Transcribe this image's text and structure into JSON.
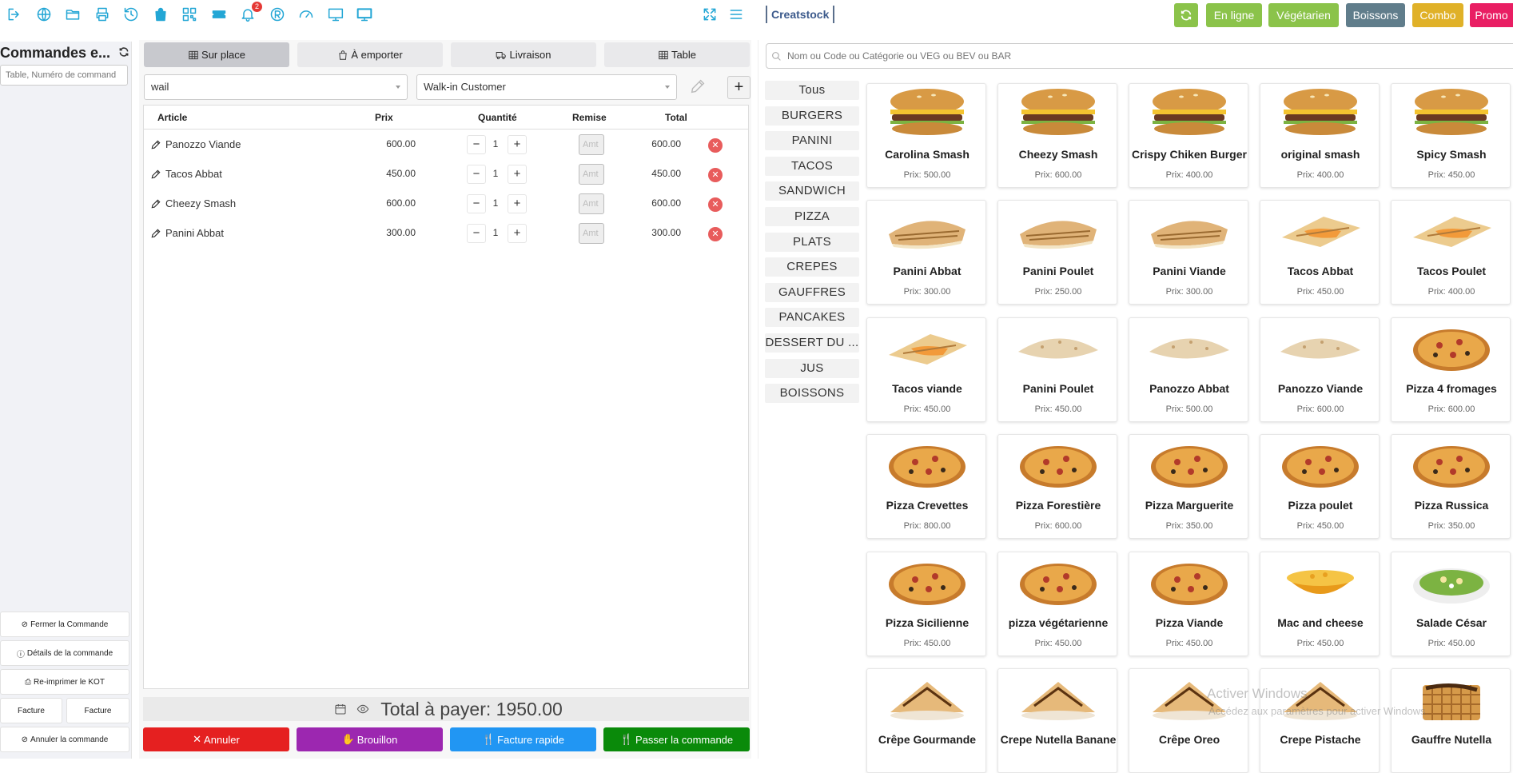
{
  "topbar": {
    "icons": [
      "logout-icon",
      "globe-icon",
      "folder-icon",
      "printer-icon",
      "history-icon",
      "shopping-bag-icon",
      "grid-icon",
      "ticket-icon",
      "bell-icon",
      "registered-icon",
      "speedometer-icon",
      "monitor-icon",
      "display-icon"
    ],
    "notification_count": "2",
    "brand": "Creatstock",
    "buttons": [
      {
        "label": "",
        "icon": "refresh-icon",
        "color": "#8bc34a"
      },
      {
        "label": "En ligne",
        "color": "#8bc34a"
      },
      {
        "label": "Végétarien",
        "color": "#8bc34a"
      },
      {
        "label": "Boissons",
        "color": "#607d8b"
      },
      {
        "label": "Combo",
        "color": "#e0b128"
      },
      {
        "label": "Promo",
        "color": "#e91e63"
      }
    ]
  },
  "left": {
    "title": "Commandes e...",
    "search_placeholder": "Table, Numéro de command",
    "buttons": {
      "close": "Fermer la Commande",
      "details": "Détails de la commande",
      "reprint": "Re-imprimer le KOT",
      "invoice1": "Facture",
      "invoice2": "Facture",
      "cancel": "Annuler la commande"
    }
  },
  "order": {
    "tabs": [
      "Sur place",
      "À emporter",
      "Livraison",
      "Table"
    ],
    "waiter": "wail",
    "customer": "Walk-in Customer",
    "headers": {
      "item": "Article",
      "price": "Prix",
      "qty": "Quantité",
      "discount": "Remise",
      "total": "Total"
    },
    "discount_placeholder": "Amt",
    "rows": [
      {
        "name": "Panozzo Viande",
        "price": "600.00",
        "qty": "1",
        "total": "600.00"
      },
      {
        "name": "Tacos Abbat",
        "price": "450.00",
        "qty": "1",
        "total": "450.00"
      },
      {
        "name": "Cheezy Smash",
        "price": "600.00",
        "qty": "1",
        "total": "600.00"
      },
      {
        "name": "Panini Abbat",
        "price": "300.00",
        "qty": "1",
        "total": "300.00"
      }
    ],
    "total_label": "Total à payer: 1950.00",
    "actions": {
      "cancel": "Annuler",
      "draft": "Brouillon",
      "quick_invoice": "Facture rapide",
      "place_order": "Passer la commande"
    }
  },
  "products": {
    "search_placeholder": "Nom ou Code ou Catégorie ou VEG ou BEV ou BAR",
    "categories": [
      "Tous",
      "BURGERS",
      "PANINI",
      "TACOS",
      "SANDWICH",
      "PIZZA",
      "PLATS",
      "CREPES",
      "GAUFFRES",
      "PANCAKES",
      "DESSERT DU ...",
      "JUS",
      "BOISSONS"
    ],
    "items": [
      {
        "name": "Carolina Smash",
        "price": "Prix: 500.00",
        "kind": "burger-image"
      },
      {
        "name": "Cheezy Smash",
        "price": "Prix: 600.00",
        "kind": "burger-image"
      },
      {
        "name": "Crispy Chiken Burger",
        "price": "Prix: 400.00",
        "kind": "burger-image"
      },
      {
        "name": "original smash",
        "price": "Prix: 400.00",
        "kind": "burger-image"
      },
      {
        "name": "Spicy Smash",
        "price": "Prix: 450.00",
        "kind": "burger-image"
      },
      {
        "name": "Panini Abbat",
        "price": "Prix: 300.00",
        "kind": "panini-image"
      },
      {
        "name": "Panini Poulet",
        "price": "Prix: 250.00",
        "kind": "panini-image"
      },
      {
        "name": "Panini Viande",
        "price": "Prix: 300.00",
        "kind": "panini-image"
      },
      {
        "name": "Tacos Abbat",
        "price": "Prix: 450.00",
        "kind": "tacos-image"
      },
      {
        "name": "Tacos Poulet",
        "price": "Prix: 400.00",
        "kind": "tacos-image"
      },
      {
        "name": "Tacos viande",
        "price": "Prix: 450.00",
        "kind": "tacos-image"
      },
      {
        "name": "Panini Poulet",
        "price": "Prix: 450.00",
        "kind": "calzone-image"
      },
      {
        "name": "Panozzo Abbat",
        "price": "Prix: 500.00",
        "kind": "calzone-image"
      },
      {
        "name": "Panozzo Viande",
        "price": "Prix: 600.00",
        "kind": "calzone-image"
      },
      {
        "name": "Pizza 4 fromages",
        "price": "Prix: 600.00",
        "kind": "pizza-image"
      },
      {
        "name": "Pizza Crevettes",
        "price": "Prix: 800.00",
        "kind": "pizza-image"
      },
      {
        "name": "Pizza Forestière",
        "price": "Prix: 600.00",
        "kind": "pizza-image"
      },
      {
        "name": "Pizza Marguerite",
        "price": "Prix: 350.00",
        "kind": "pizza-image"
      },
      {
        "name": "Pizza poulet",
        "price": "Prix: 450.00",
        "kind": "pizza-image"
      },
      {
        "name": "Pizza Russica",
        "price": "Prix: 350.00",
        "kind": "pizza-image"
      },
      {
        "name": "Pizza Sicilienne",
        "price": "Prix: 450.00",
        "kind": "pizza-image"
      },
      {
        "name": "pizza végétarienne",
        "price": "Prix: 450.00",
        "kind": "pizza-image"
      },
      {
        "name": "Pizza Viande",
        "price": "Prix: 450.00",
        "kind": "pizza-image"
      },
      {
        "name": "Mac and cheese",
        "price": "Prix: 450.00",
        "kind": "pasta-image"
      },
      {
        "name": "Salade César",
        "price": "Prix: 450.00",
        "kind": "salad-image"
      },
      {
        "name": "Crêpe Gourmande",
        "price": "",
        "kind": "crepe-image"
      },
      {
        "name": "Crepe Nutella Banane",
        "price": "",
        "kind": "crepe-image"
      },
      {
        "name": "Crêpe Oreo",
        "price": "",
        "kind": "crepe-image"
      },
      {
        "name": "Crepe Pistache",
        "price": "",
        "kind": "crepe-image"
      },
      {
        "name": "Gauffre Nutella",
        "price": "",
        "kind": "waffle-image"
      }
    ]
  },
  "watermark": {
    "line1": "Activer Windows",
    "line2": "Accédez aux paramètres pour activer Windows."
  }
}
